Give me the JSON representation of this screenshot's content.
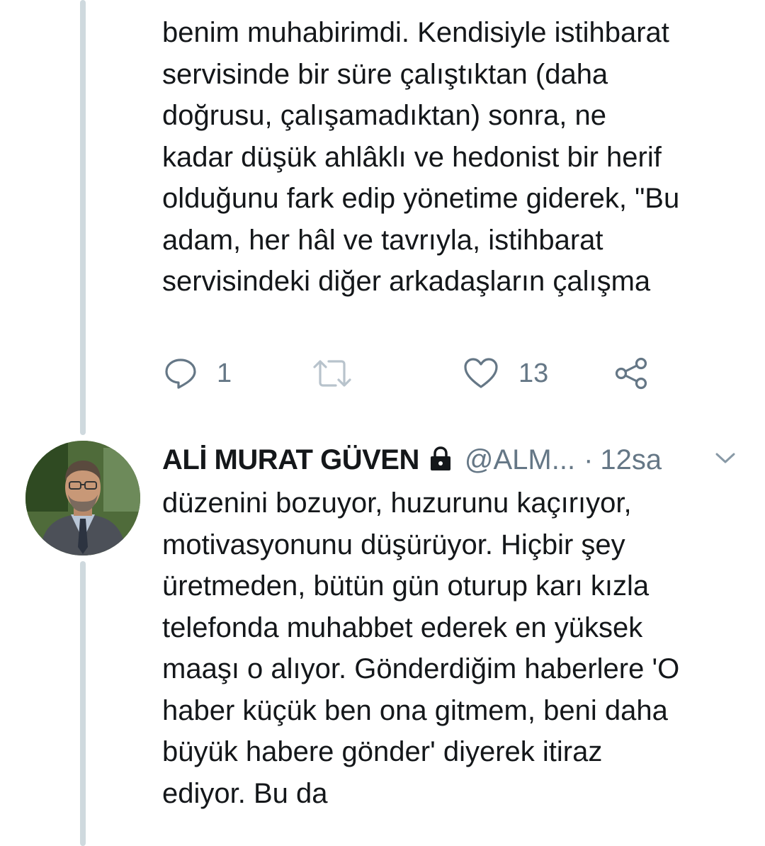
{
  "colors": {
    "text": "#14171a",
    "secondary": "#657786",
    "thread_line": "#cfd9de"
  },
  "tweet1": {
    "text": "benim muhabirimdi. Kendisiyle istihbarat\nservisinde bir süre çalıştıktan (daha\ndoğrusu, çalışamadıktan) sonra, ne\nkadar düşük ahlâklı ve hedonist bir herif\nolduğunu fark edip yönetime giderek, \"Bu\nadam, her hâl ve tavrıyla, istihbarat\nservisindeki diğer arkadaşların çalışma",
    "actions": {
      "reply_icon": "reply-icon",
      "reply_count": "1",
      "retweet_icon": "retweet-icon",
      "like_icon": "heart-icon",
      "like_count": "13",
      "share_icon": "share-icon"
    }
  },
  "tweet2": {
    "display_name": "ALİ MURAT GÜVEN",
    "lock_icon": "lock-icon",
    "handle": "@ALM...",
    "separator": "·",
    "time": "12sa",
    "menu_icon": "chevron-down-icon",
    "text": "düzenini bozuyor, huzurunu kaçırıyor,\nmotivasyonunu düşürüyor. Hiçbir şey\nüretmeden, bütün gün oturup karı kızla\ntelefonda muhabbet ederek en yüksek\nmaaşı o alıyor. Gönderdiğim haberlere 'O\nhaber küçük ben ona gitmem, beni daha\nbüyük habere gönder' diyerek itiraz\nediyor. Bu da"
  }
}
